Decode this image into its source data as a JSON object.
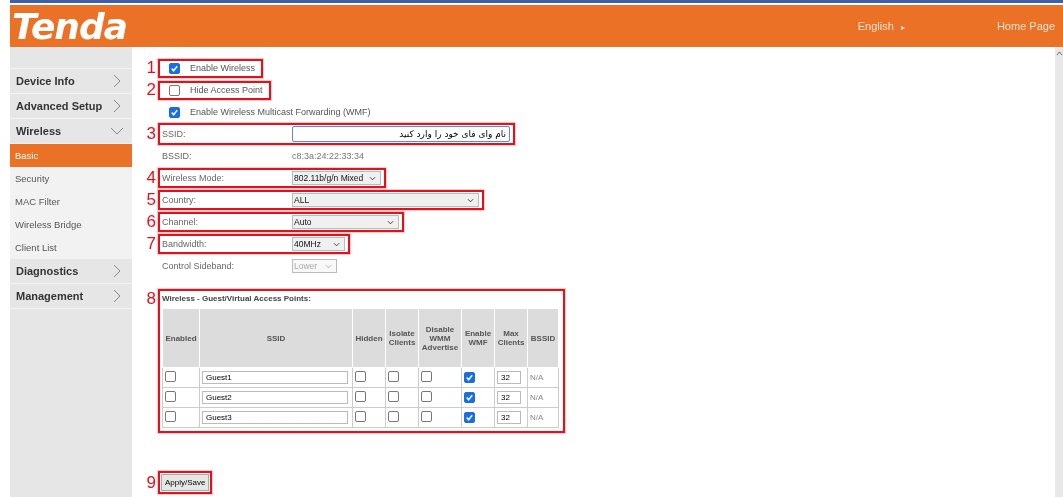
{
  "header": {
    "logo": "Tenda",
    "language": "English",
    "language_arrow": "▸",
    "home": "Home Page"
  },
  "sidebar": {
    "items": [
      {
        "label": "Device Info",
        "expanded": false
      },
      {
        "label": "Advanced Setup",
        "expanded": false
      },
      {
        "label": "Wireless",
        "expanded": true,
        "children": [
          {
            "label": "Basic",
            "selected": true
          },
          {
            "label": "Security",
            "selected": false
          },
          {
            "label": "MAC Filter",
            "selected": false
          },
          {
            "label": "Wireless Bridge",
            "selected": false
          },
          {
            "label": "Client List",
            "selected": false
          }
        ]
      },
      {
        "label": "Diagnostics",
        "expanded": false
      },
      {
        "label": "Management",
        "expanded": false
      }
    ]
  },
  "checkboxes": [
    {
      "label": "Enable Wireless",
      "checked": true,
      "annotation": "1"
    },
    {
      "label": "Hide Access Point",
      "checked": false,
      "annotation": "2"
    },
    {
      "label": "Enable Wireless Multicast Forwarding (WMF)",
      "checked": true
    }
  ],
  "fields": [
    {
      "kind": "text",
      "label": "SSID:",
      "value": "نام وای فای خود را وارد کنید",
      "annotation": "3"
    },
    {
      "kind": "static",
      "label": "BSSID:",
      "value": "c8:3a:24:22:33:34"
    },
    {
      "kind": "select",
      "label": "Wireless Mode:",
      "value": "802.11b/g/n Mixed",
      "annotation": "4",
      "disabled": false
    },
    {
      "kind": "select",
      "label": "Country:",
      "value": "ALL",
      "annotation": "5",
      "disabled": false
    },
    {
      "kind": "select",
      "label": "Channel:",
      "value": "Auto",
      "annotation": "6",
      "disabled": false
    },
    {
      "kind": "select",
      "label": "Bandwidth:",
      "value": "40MHz",
      "annotation": "7",
      "disabled": false
    },
    {
      "kind": "select",
      "label": "Control Sideband:",
      "value": "Lower",
      "disabled": true
    }
  ],
  "guest_table": {
    "title": "Wireless - Guest/Virtual Access Points:",
    "annotation": "8",
    "columns": [
      "Enabled",
      "SSID",
      "Hidden",
      "Isolate Clients",
      "Disable WMM Advertise",
      "Enable WMF",
      "Max Clients",
      "BSSID"
    ],
    "rows": [
      {
        "enabled": false,
        "ssid": "Guest1",
        "hidden": false,
        "isolate": false,
        "disable_wmm": false,
        "enable_wmf": true,
        "max_clients": "32",
        "bssid": "N/A"
      },
      {
        "enabled": false,
        "ssid": "Guest2",
        "hidden": false,
        "isolate": false,
        "disable_wmm": false,
        "enable_wmf": true,
        "max_clients": "32",
        "bssid": "N/A"
      },
      {
        "enabled": false,
        "ssid": "Guest3",
        "hidden": false,
        "isolate": false,
        "disable_wmm": false,
        "enable_wmf": true,
        "max_clients": "32",
        "bssid": "N/A"
      }
    ]
  },
  "apply_button": {
    "label": "Apply/Save",
    "annotation": "9"
  }
}
